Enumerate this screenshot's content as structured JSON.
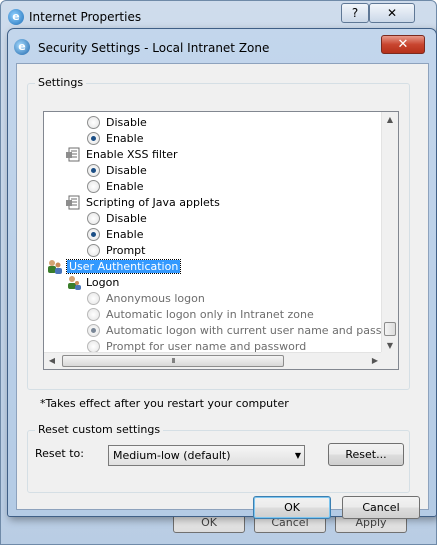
{
  "background_window": {
    "title": "Internet Properties",
    "help_label": "?",
    "close_label": "✕",
    "buttons": [
      "OK",
      "Cancel",
      "Apply"
    ]
  },
  "dialog": {
    "title": "Security Settings - Local Intranet Zone",
    "close_label": "✕"
  },
  "settings": {
    "group_label": "Settings",
    "rows": [
      {
        "kind": "radio",
        "label": "Disable",
        "checked": false,
        "dim": false
      },
      {
        "kind": "radio",
        "label": "Enable",
        "checked": true,
        "dim": false
      },
      {
        "kind": "header",
        "label": "Enable XSS filter",
        "icon": "settings-page-icon"
      },
      {
        "kind": "radio",
        "label": "Disable",
        "checked": true,
        "dim": false
      },
      {
        "kind": "radio",
        "label": "Enable",
        "checked": false,
        "dim": false
      },
      {
        "kind": "header",
        "label": "Scripting of Java applets",
        "icon": "settings-page-icon"
      },
      {
        "kind": "radio",
        "label": "Disable",
        "checked": false,
        "dim": false
      },
      {
        "kind": "radio",
        "label": "Enable",
        "checked": true,
        "dim": false
      },
      {
        "kind": "radio",
        "label": "Prompt",
        "checked": false,
        "dim": false
      },
      {
        "kind": "category",
        "label": "User Authentication",
        "icon": "users-icon",
        "selected": true
      },
      {
        "kind": "subheader",
        "label": "Logon",
        "icon": "user-icon"
      },
      {
        "kind": "radio",
        "label": "Anonymous logon",
        "checked": false,
        "dim": true
      },
      {
        "kind": "radio",
        "label": "Automatic logon only in Intranet zone",
        "checked": false,
        "dim": true
      },
      {
        "kind": "radio",
        "label": "Automatic logon with current user name and password",
        "checked": true,
        "dim": true
      },
      {
        "kind": "radio",
        "label": "Prompt for user name and password",
        "checked": false,
        "dim": true
      }
    ],
    "hscroll_grip": "III",
    "note": "*Takes effect after you restart your computer"
  },
  "reset": {
    "group_label": "Reset custom settings",
    "reset_to_label": "Reset to:",
    "selected_level": "Medium-low (default)",
    "reset_button": "Reset..."
  },
  "footer": {
    "ok_label": "OK",
    "cancel_label": "Cancel"
  }
}
